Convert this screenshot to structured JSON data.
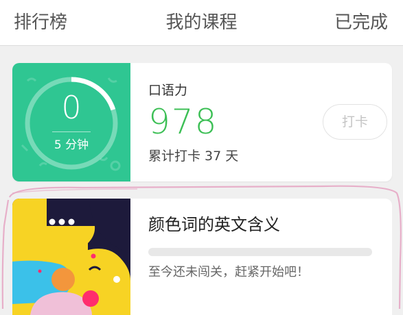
{
  "topbar": {
    "left_tab": "排行榜",
    "title": "我的课程",
    "right_tab": "已完成"
  },
  "daily_card": {
    "timer_value": "0",
    "timer_label": "5 分钟",
    "timer_progress_fraction": 0.2,
    "skill_name": "口语力",
    "score": "978",
    "checkin_summary": "累计打卡 37 天",
    "checkin_button": "打卡",
    "colors": {
      "panel": "#2fc692",
      "score": "#3cbf55"
    }
  },
  "lesson_card": {
    "title": "颜色词的英文含义",
    "progress_fraction": 0,
    "status": "至今还未闯关，赶紧开始吧！",
    "thumbnail_icon": "colorful-abstract-art"
  },
  "annotation": {
    "highlight_color": "#e6a7c4"
  }
}
